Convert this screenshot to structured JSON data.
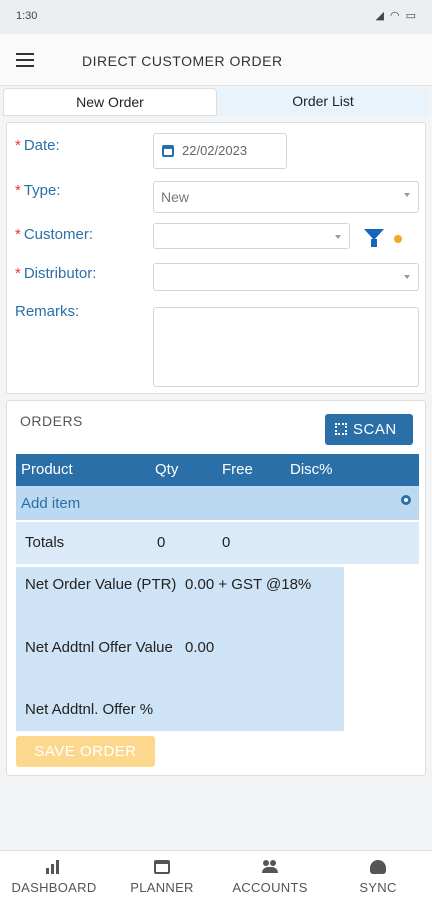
{
  "status": {
    "time": "1:30"
  },
  "app": {
    "title": "DIRECT CUSTOMER ORDER"
  },
  "tabs": [
    {
      "label": "New Order",
      "active": true
    },
    {
      "label": "Order List",
      "active": false
    }
  ],
  "form": {
    "required_marker": "*",
    "date_label": "Date:",
    "date_value": "22/02/2023",
    "type_label": "Type:",
    "type_value": "New",
    "customer_label": "Customer:",
    "customer_value": "",
    "distributor_label": "Distributor:",
    "distributor_value": "",
    "remarks_label": "Remarks:",
    "remarks_value": ""
  },
  "orders": {
    "title": "ORDERS",
    "scan_label": "SCAN",
    "columns": [
      "Product",
      "Qty",
      "Free",
      "Disc%"
    ],
    "add_item_label": "Add item",
    "totals_label": "Totals",
    "totals_qty": "0",
    "totals_free": "0",
    "net_order_value_label": "Net Order Value (PTR)",
    "net_order_value": "0.00 + GST @18%",
    "net_addtnl_offer_value_label": "Net Addtnl Offer Value",
    "net_addtnl_offer_value": "0.00",
    "net_addtnl_offer_pct_label": "Net Addtnl. Offer %",
    "save_label": "SAVE ORDER"
  },
  "nav": [
    {
      "label": "DASHBOARD",
      "icon": "bar-chart-icon"
    },
    {
      "label": "PLANNER",
      "icon": "calendar-icon"
    },
    {
      "label": "ACCOUNTS",
      "icon": "people-icon"
    },
    {
      "label": "SYNC",
      "icon": "cloud-sync-icon"
    }
  ],
  "colors": {
    "accent": "#2a6fa8",
    "required": "#e53935",
    "filter": "#1565c0",
    "dot": "#f5a623",
    "save_disabled": "#fcd88f"
  }
}
